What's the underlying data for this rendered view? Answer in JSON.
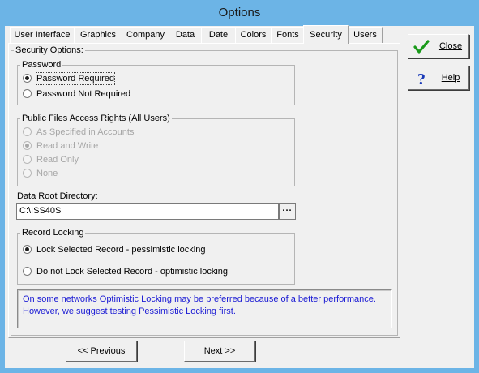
{
  "window": {
    "title": "Options"
  },
  "tabs": [
    {
      "label": "User Interface",
      "active": false
    },
    {
      "label": "Graphics",
      "active": false
    },
    {
      "label": "Company",
      "active": false
    },
    {
      "label": "Data",
      "active": false
    },
    {
      "label": "Date",
      "active": false
    },
    {
      "label": "Colors",
      "active": false
    },
    {
      "label": "Fonts",
      "active": false
    },
    {
      "label": "Security",
      "active": true
    },
    {
      "label": "Users",
      "active": false
    }
  ],
  "security": {
    "group_label": "Security Options:",
    "password": {
      "label": "Password",
      "required": "Password Required",
      "not_required": "Password Not Required",
      "selected": "required"
    },
    "public_files": {
      "label": "Public Files Access Rights (All Users)",
      "opt_accounts": "As Specified in Accounts",
      "opt_read_write": "Read and Write",
      "opt_read_only": "Read Only",
      "opt_none": "None",
      "selected": "read_write"
    },
    "data_root": {
      "label": "Data Root Directory:",
      "value": "C:\\ISS40S",
      "browse_label": "..."
    },
    "record_locking": {
      "label": "Record Locking",
      "lock": "Lock Selected Record - pessimistic locking",
      "no_lock": "Do not Lock Selected Record - optimistic locking",
      "selected": "lock"
    },
    "info_text": "On some networks Optimistic Locking may be preferred because of a better performance. However, we suggest testing Pessimistic Locking first."
  },
  "buttons": {
    "close": "Close",
    "help": "Help",
    "previous": "<< Previous",
    "next": "Next >>"
  },
  "colors": {
    "close_icon": "#1a9a1a",
    "help_icon": "#1a3ab8",
    "info_text": "#1a1ad4"
  }
}
